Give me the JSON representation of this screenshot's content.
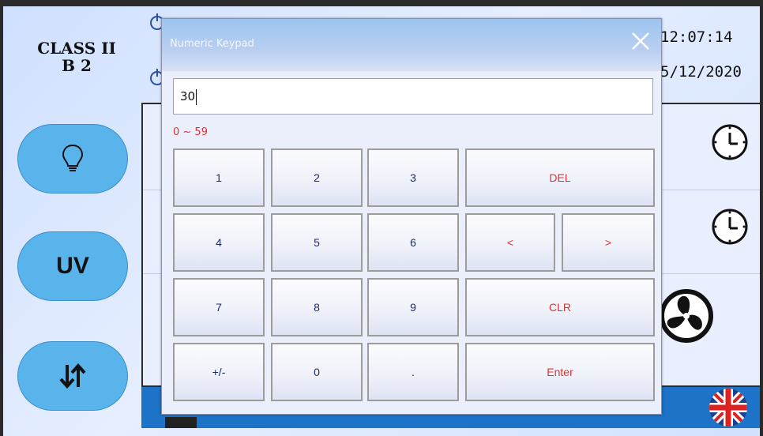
{
  "header": {
    "class_line1": "CLASS II",
    "class_line2": "B 2",
    "time": "12:07:14",
    "date": "5/12/2020"
  },
  "sidebar": {
    "light_icon": "lightbulb-icon",
    "uv_label": "UV",
    "arrows_icon": "up-down-arrows-icon"
  },
  "status_icons": [
    "clock-icon",
    "clock-icon",
    "fan-icon",
    "uk-flag-icon"
  ],
  "colors": {
    "side_button": "#5ab4ec",
    "bottom_bar": "#1d73c8",
    "accent_red": "#e0312f",
    "key_text": "#1b2a6b"
  },
  "keypad": {
    "title": "Numeric Keypad",
    "value": "30",
    "range": "0 ~ 59",
    "keys": {
      "k1": "1",
      "k2": "2",
      "k3": "3",
      "del": "DEL",
      "k4": "4",
      "k5": "5",
      "k6": "6",
      "left": "<",
      "right": ">",
      "k7": "7",
      "k8": "8",
      "k9": "9",
      "clr": "CLR",
      "sign": "+/-",
      "k0": "0",
      "dot": ".",
      "enter": "Enter"
    }
  }
}
